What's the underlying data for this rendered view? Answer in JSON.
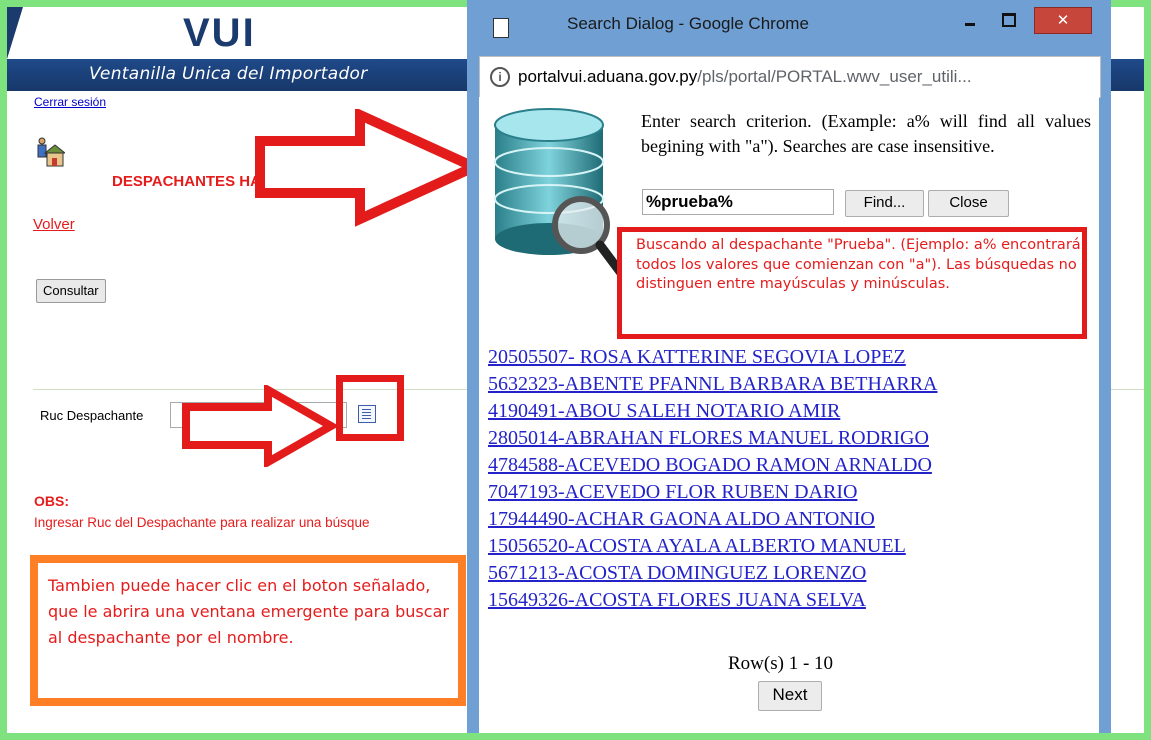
{
  "brand": {
    "logo": "VUI",
    "tagline": "Ventanilla Unica del Importador"
  },
  "page": {
    "logout": "Cerrar sesión",
    "heading": "DESPACHANTES HABILITADOS EN V",
    "back": "Volver",
    "consult_button": "Consultar",
    "ruc_label": "Ruc Despachante",
    "ruc_value": "",
    "obs_title": "OBS:",
    "obs_text": "Ingresar Ruc del Despachante para realizar una búsque"
  },
  "annotation_box": {
    "text": "Tambien puede hacer clic en el boton señalado, que le abrira una ventana emergente para buscar al despachante por el nombre."
  },
  "popup": {
    "window_title": "Search Dialog - Google Chrome",
    "url_host": "portalvui.aduana.gov.py",
    "url_path": "/pls/portal/PORTAL.wwv_user_utili...",
    "criterion_text": "Enter search criterion. (Example: a% will find all values begining with \"a\"). Searches are case insensitive.",
    "search_value": "%prueba%",
    "find_label": "Find...",
    "close_label": "Close",
    "note_text": "Buscando al despachante \"Prueba\". (Ejemplo: a% encontrará todos los valores que comienzan con \"a\"). Las búsquedas no distinguen entre mayúsculas y minúsculas.",
    "results": [
      "20505507- ROSA KATTERINE SEGOVIA LOPEZ ",
      "5632323-ABENTE PFANNL BARBARA BETHARRA",
      "4190491-ABOU SALEH NOTARIO AMIR ",
      "2805014-ABRAHAN FLORES MANUEL RODRIGO",
      "4784588-ACEVEDO BOGADO RAMON ARNALDO",
      "7047193-ACEVEDO FLOR RUBEN DARIO",
      "17944490-ACHAR GAONA ALDO ANTONIO",
      "15056520-ACOSTA AYALA ALBERTO MANUEL",
      "5671213-ACOSTA DOMINGUEZ LORENZO ",
      "15649326-ACOSTA FLORES JUANA SELVA"
    ],
    "rows_text": "Row(s) 1 - 10",
    "next_label": "Next"
  },
  "colors": {
    "brand_blue": "#1b3a6e",
    "highlight_red": "#e41b1b",
    "callout_orange": "#ff7f27",
    "link_blue": "#2323c9",
    "window_frame": "#6f9fd3"
  },
  "icons": [
    "house-person-icon",
    "list-lookup-icon",
    "database-search-icon",
    "info-icon",
    "document-icon",
    "minimize-icon",
    "maximize-icon",
    "close-icon"
  ]
}
